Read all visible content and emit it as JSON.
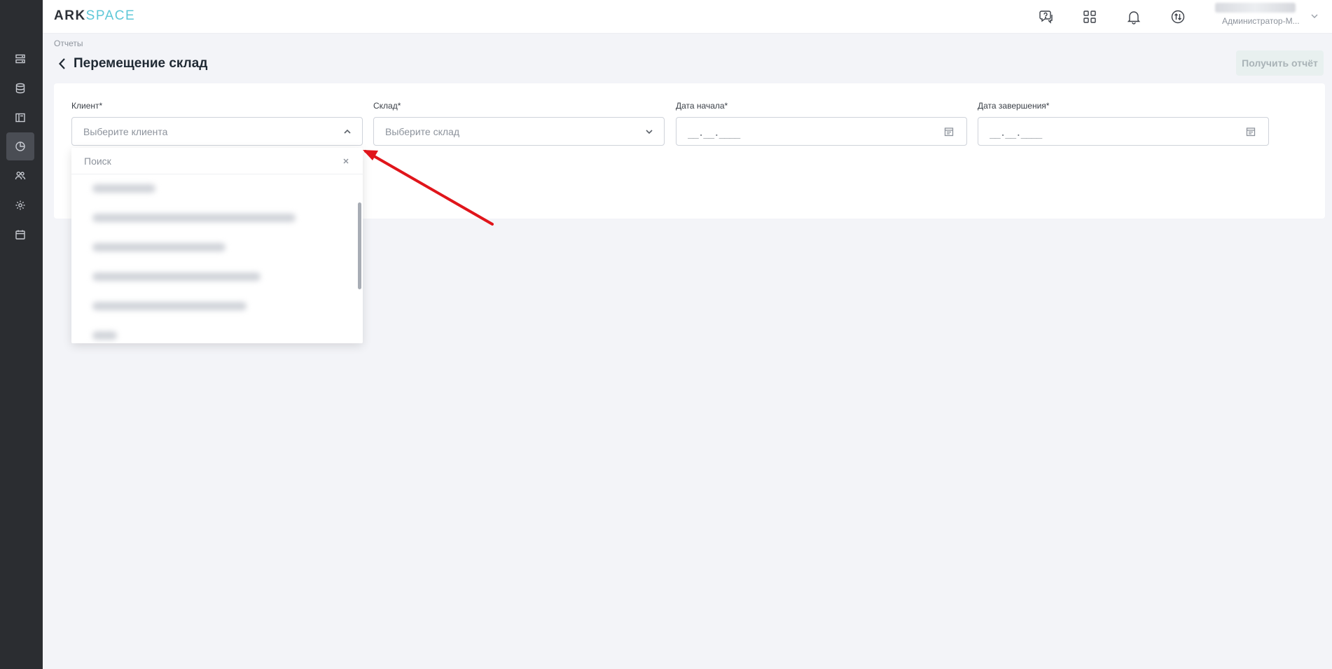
{
  "app": {
    "logo_ark": "ARK",
    "logo_space": "SPACE"
  },
  "sidebar": {
    "items": [
      {
        "icon": "servers-icon",
        "active": false
      },
      {
        "icon": "database-icon",
        "active": false
      },
      {
        "icon": "layout-icon",
        "active": false
      },
      {
        "icon": "reports-icon",
        "active": true
      },
      {
        "icon": "users-icon",
        "active": false
      },
      {
        "icon": "settings-icon",
        "active": false
      },
      {
        "icon": "calendar-icon",
        "active": false
      }
    ]
  },
  "topbar": {
    "icons": [
      "support-chat-icon",
      "apps-grid-icon",
      "bell-icon",
      "exchange-icon"
    ],
    "user_role": "Администратор-М..."
  },
  "header": {
    "breadcrumb": "Отчеты",
    "title": "Перемещение склад",
    "get_report_label": "Получить отчёт"
  },
  "form": {
    "client": {
      "label": "Клиент*",
      "placeholder": "Выберите клиента"
    },
    "warehouse": {
      "label": "Склад*",
      "placeholder": "Выберите склад"
    },
    "start_date": {
      "label": "Дата начала*",
      "mask": "__.__.____"
    },
    "end_date": {
      "label": "Дата завершения*",
      "mask": "__.__.____"
    }
  },
  "dropdown": {
    "search_placeholder": "Поиск",
    "items_count_visible": 6
  },
  "colors": {
    "sidebar_bg": "#2b2d31",
    "accent": "#5fc8d8",
    "annotation_arrow": "#e0151b"
  }
}
